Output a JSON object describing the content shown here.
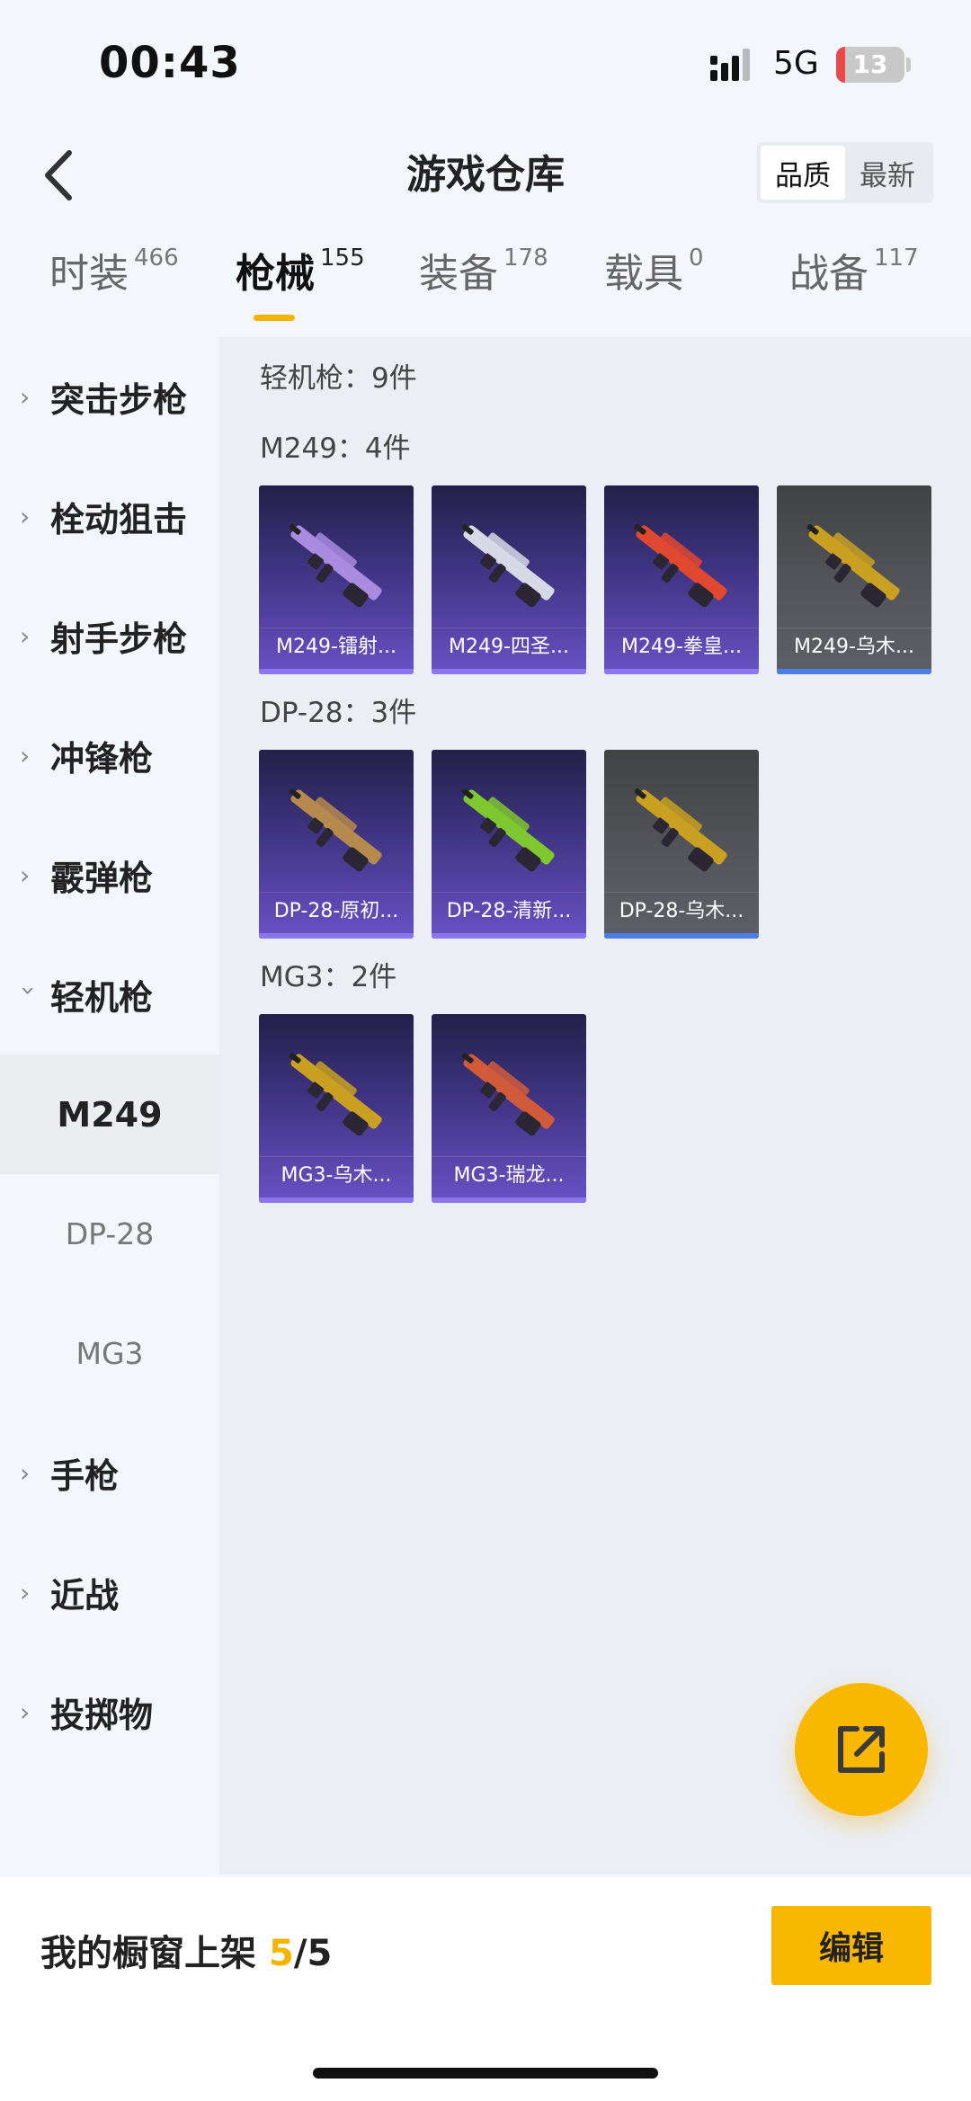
{
  "status_bar": {
    "time": "00:43",
    "network": "5G",
    "battery": "13",
    "battery_level_percent": 13
  },
  "header": {
    "title": "游戏仓库",
    "back_icon": "chevron-left-icon",
    "sort_options": [
      "品质",
      "最新"
    ],
    "sort_selected": "品质"
  },
  "category_tabs": [
    {
      "label": "时装",
      "count": "466"
    },
    {
      "label": "枪械",
      "count": "155",
      "active": true
    },
    {
      "label": "装备",
      "count": "178"
    },
    {
      "label": "载具",
      "count": "0"
    },
    {
      "label": "战备",
      "count": "117"
    }
  ],
  "sidebar": {
    "items": [
      "突击步枪",
      "栓动狙击",
      "射手步枪",
      "冲锋枪",
      "霰弹枪",
      "轻机枪"
    ],
    "expanded": "轻机枪",
    "sub_items": [
      "M249",
      "DP-28",
      "MG3"
    ],
    "sub_active": "M249",
    "items_after": [
      "手枪",
      "近战",
      "投掷物"
    ]
  },
  "content": {
    "category_summary": "轻机枪：9件",
    "groups": [
      {
        "title": "M249：4件",
        "items": [
          {
            "name": "M249-镭射...",
            "rarity": "purple",
            "gun_color": "#a98be0"
          },
          {
            "name": "M249-四圣...",
            "rarity": "purple",
            "gun_color": "#d7d9e6"
          },
          {
            "name": "M249-拳皇...",
            "rarity": "purple",
            "gun_color": "#e0482f"
          },
          {
            "name": "M249-乌木...",
            "rarity": "gray",
            "gun_color": "#c9a021"
          }
        ]
      },
      {
        "title": "DP-28：3件",
        "items": [
          {
            "name": "DP-28-原初...",
            "rarity": "purple",
            "gun_color": "#b68a4c"
          },
          {
            "name": "DP-28-清新...",
            "rarity": "purple",
            "gun_color": "#7fc72e"
          },
          {
            "name": "DP-28-乌木...",
            "rarity": "gray",
            "gun_color": "#c9a021"
          }
        ]
      },
      {
        "title": "MG3：2件",
        "items": [
          {
            "name": "MG3-乌木...",
            "rarity": "purple",
            "gun_color": "#c9a021"
          },
          {
            "name": "MG3-瑞龙...",
            "rarity": "purple",
            "gun_color": "#d05a3a"
          }
        ]
      }
    ]
  },
  "fab": {
    "icon": "share-external-icon"
  },
  "bottom_bar": {
    "label": "我的橱窗上架",
    "count": "5",
    "total": "/5",
    "edit_label": "编辑"
  },
  "colors": {
    "accent": "#f9b700",
    "purple_card": "#403483",
    "gray_card": "#55575c"
  }
}
